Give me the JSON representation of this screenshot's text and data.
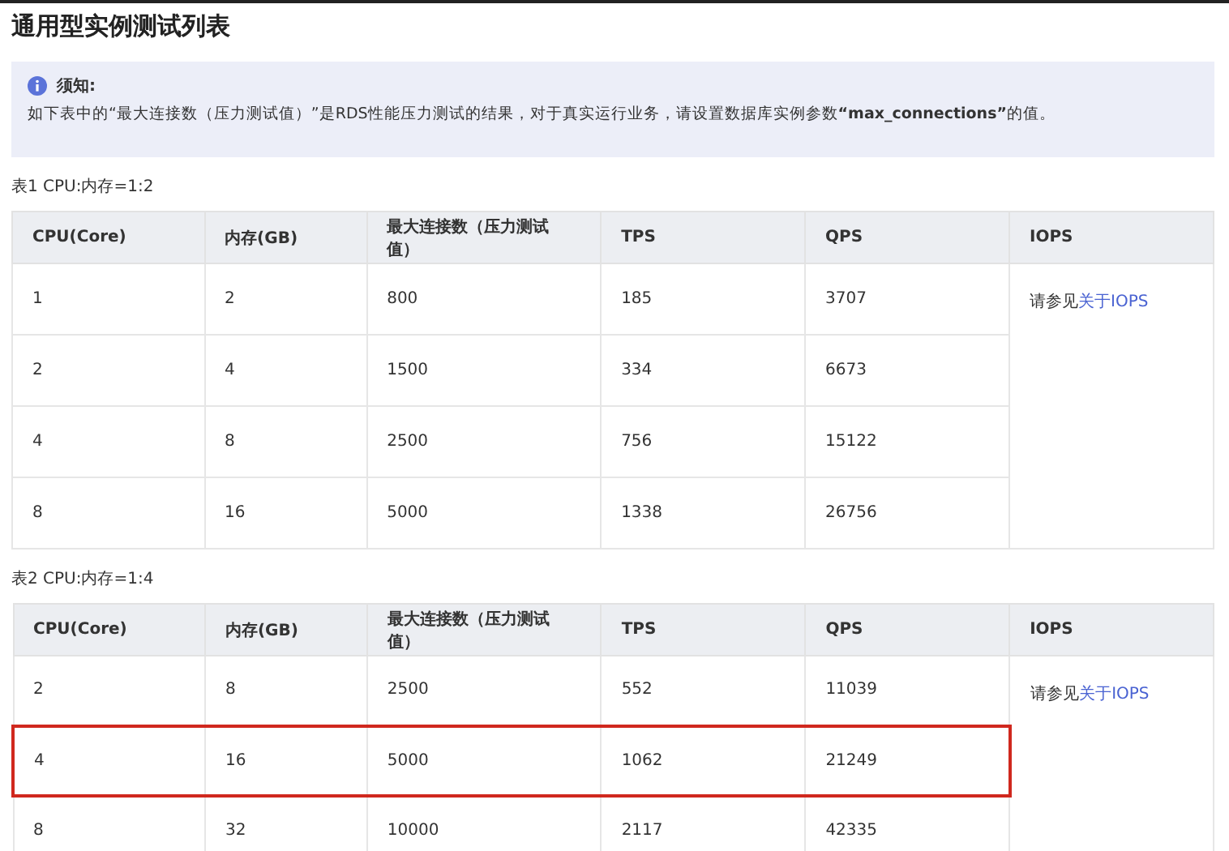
{
  "title": "通用型实例测试列表",
  "note": {
    "heading": "须知:",
    "text": "如下表中的“最大连接数（压力测试值）”是RDS性能压力测试的结果，对于真实运行业务，请设置数据库实例参数**“max_connections”**的值。"
  },
  "tables": [
    {
      "caption": "表1 CPU:内存=1:2",
      "columns": [
        "CPU(Core)",
        "内存(GB)",
        "最大连接数（压力测试值）",
        "TPS",
        "QPS",
        "IOPS"
      ],
      "rows": [
        {
          "cells": [
            "1",
            "2",
            "800",
            "185",
            "3707"
          ],
          "highlighted": false
        },
        {
          "cells": [
            "2",
            "4",
            "1500",
            "334",
            "6673"
          ],
          "highlighted": false
        },
        {
          "cells": [
            "4",
            "8",
            "2500",
            "756",
            "15122"
          ],
          "highlighted": false
        },
        {
          "cells": [
            "8",
            "16",
            "5000",
            "1338",
            "26756"
          ],
          "highlighted": false
        }
      ],
      "iops": {
        "text": "请参见",
        "link": "关于IOPS"
      }
    },
    {
      "caption": "表2 CPU:内存=1:4",
      "columns": [
        "CPU(Core)",
        "内存(GB)",
        "最大连接数（压力测试值）",
        "TPS",
        "QPS",
        "IOPS"
      ],
      "rows": [
        {
          "cells": [
            "2",
            "8",
            "2500",
            "552",
            "11039"
          ],
          "highlighted": false
        },
        {
          "cells": [
            "4",
            "16",
            "5000",
            "1062",
            "21249"
          ],
          "highlighted": true
        },
        {
          "cells": [
            "8",
            "32",
            "10000",
            "2117",
            "42335"
          ],
          "highlighted": false
        }
      ],
      "iops": {
        "text": "请参见",
        "link": "关于IOPS"
      }
    }
  ]
}
